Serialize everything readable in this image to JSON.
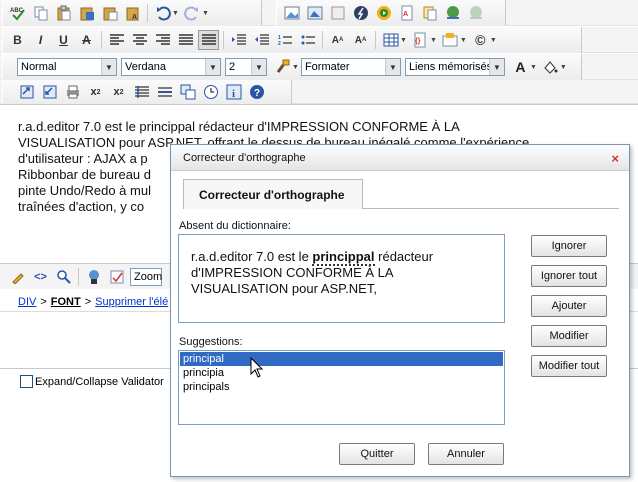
{
  "toolbar": {
    "font_name": "Normal",
    "font_face": "Verdana",
    "font_size": "2",
    "format": "Formater",
    "links": "Liens mémorisés",
    "text_color_label": "A"
  },
  "editor": {
    "lines": [
      "r.a.d.editor 7.0 est le princippal rédacteur d'IMPRESSION CONFORME À LA",
      "VISUALISATION pour ASP.NET, offrant le dessus de bureau inégalé comme l'expérience",
      "d'utilisateur : AJAX a p",
      "Ribbonbar de bureau d",
      "pinte Undo/Redo à mul",
      "traînées d'action, y co"
    ]
  },
  "modebar": {
    "zoom_label": "Zoom"
  },
  "path": {
    "div": "DIV",
    "sep": ">",
    "font": "FONT",
    "remove": "Supprimer l'élé"
  },
  "validator": {
    "label": "Expand/Collapse Validator"
  },
  "dialog": {
    "title": "Correcteur d'orthographe",
    "tab": "Correcteur d'orthographe",
    "missing_label": "Absent du dictionnaire:",
    "missing_before": "r.a.d.editor 7.0 est le ",
    "missing_word": "princippal",
    "missing_after": " rédacteur d'IMPRESSION CONFORME À LA VISUALISATION pour ASP.NET,",
    "suggestions_label": "Suggestions:",
    "suggestions": [
      "principal",
      "principia",
      "principals"
    ],
    "selected_suggestion": "principal",
    "buttons": {
      "ignore": "Ignorer",
      "ignore_all": "Ignorer tout",
      "add": "Ajouter",
      "change": "Modifier",
      "change_all": "Modifier tout",
      "quit": "Quitter",
      "cancel": "Annuler"
    },
    "close_symbol": "×"
  },
  "colors": {
    "accent": "#316ac5",
    "link": "#0033cc",
    "close": "#cc3333"
  }
}
